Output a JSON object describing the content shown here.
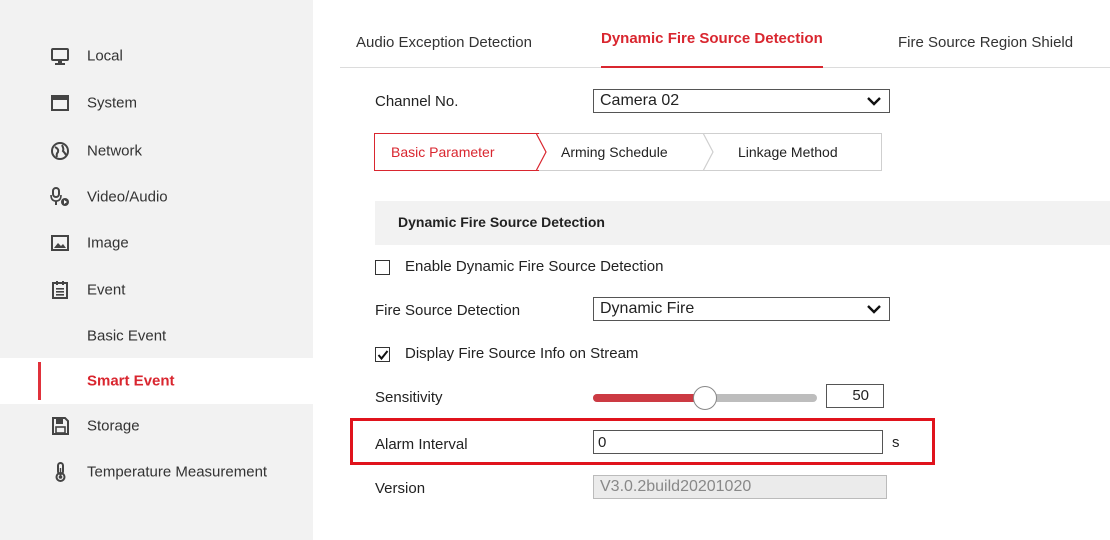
{
  "sidebar": {
    "items": [
      {
        "label": "Local",
        "icon": "monitor-icon"
      },
      {
        "label": "System",
        "icon": "system-window-icon"
      },
      {
        "label": "Network",
        "icon": "globe-icon"
      },
      {
        "label": "Video/Audio",
        "icon": "video-audio-icon"
      },
      {
        "label": "Image",
        "icon": "image-icon"
      },
      {
        "label": "Event",
        "icon": "calendar-icon"
      },
      {
        "label": "Basic Event"
      },
      {
        "label": "Smart Event",
        "active": true
      },
      {
        "label": "Storage",
        "icon": "floppy-disk-icon"
      },
      {
        "label": "Temperature Measurement",
        "icon": "thermometer-icon"
      }
    ]
  },
  "tabs": [
    {
      "label": "Audio Exception Detection"
    },
    {
      "label": "Dynamic Fire Source Detection",
      "active": true
    },
    {
      "label": "Fire Source Region Shield"
    }
  ],
  "form": {
    "channel_label": "Channel No.",
    "channel_value": "Camera 02",
    "subtabs": [
      "Basic Parameter",
      "Arming Schedule",
      "Linkage Method"
    ],
    "section_title": "Dynamic Fire Source Detection",
    "enable_label": "Enable Dynamic Fire Source Detection",
    "enable_checked": false,
    "fire_detection_label": "Fire Source Detection",
    "fire_detection_value": "Dynamic Fire",
    "display_info_label": "Display Fire Source Info on Stream",
    "display_info_checked": true,
    "sensitivity_label": "Sensitivity",
    "sensitivity_value": "50",
    "sensitivity_percent": 50,
    "alarm_interval_label": "Alarm Interval",
    "alarm_interval_value": "0",
    "alarm_interval_unit": "s",
    "version_label": "Version",
    "version_value": "V3.0.2build20201020"
  },
  "colors": {
    "accent": "#d9262f",
    "highlight": "#e0131c",
    "sidebar_bg": "#f2f2f2"
  }
}
